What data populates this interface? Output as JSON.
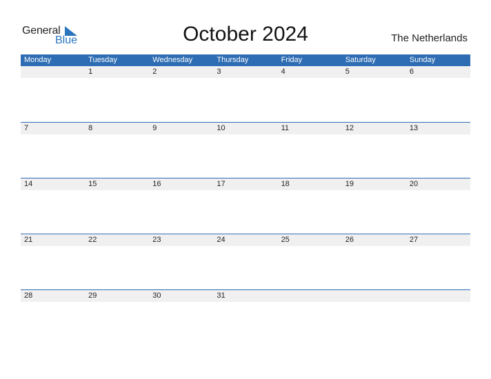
{
  "logo": {
    "line1": "General",
    "line2": "Blue"
  },
  "title": "October 2024",
  "country": "The Netherlands",
  "weekdays": [
    "Monday",
    "Tuesday",
    "Wednesday",
    "Thursday",
    "Friday",
    "Saturday",
    "Sunday"
  ],
  "weeks": [
    [
      "",
      "1",
      "2",
      "3",
      "4",
      "5",
      "6"
    ],
    [
      "7",
      "8",
      "9",
      "10",
      "11",
      "12",
      "13"
    ],
    [
      "14",
      "15",
      "16",
      "17",
      "18",
      "19",
      "20"
    ],
    [
      "21",
      "22",
      "23",
      "24",
      "25",
      "26",
      "27"
    ],
    [
      "28",
      "29",
      "30",
      "31",
      "",
      "",
      ""
    ]
  ],
  "colors": {
    "accent": "#2e6db3",
    "date_bar": "#f0f0f0",
    "logo_blue": "#2a74c0"
  }
}
